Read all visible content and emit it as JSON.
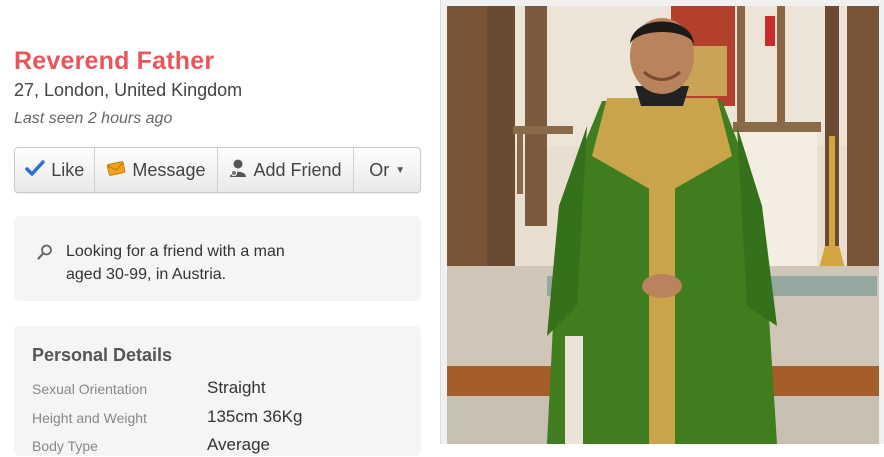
{
  "profile": {
    "name": "Reverend Father",
    "location": "27, London, United Kingdom",
    "last_seen": "Last seen 2 hours ago"
  },
  "actions": {
    "like": "Like",
    "message": "Message",
    "add_friend": "Add Friend",
    "or": "Or"
  },
  "looking_for": {
    "text": "Looking for a friend with a man aged 30-99, in Austria."
  },
  "personal_details": {
    "title": "Personal Details",
    "rows": [
      {
        "label": "Sexual Orientation",
        "value": "Straight"
      },
      {
        "label": "Height and Weight",
        "value": "135cm 36Kg"
      },
      {
        "label": "Body Type",
        "value": "Average"
      }
    ]
  },
  "colors": {
    "name": "#e8555a",
    "like_icon": "#2b6fd6",
    "message_icon": "#f2a21c",
    "vestment": "#3f7d1e",
    "stole": "#c9a44a"
  },
  "icons": [
    "checkmark-icon",
    "envelope-icon",
    "person-icon",
    "caret-down-icon",
    "search-icon"
  ]
}
